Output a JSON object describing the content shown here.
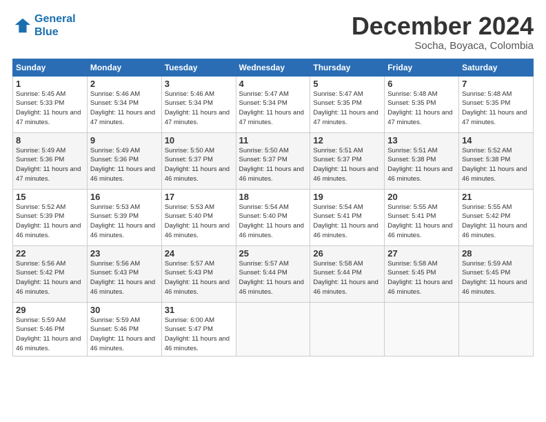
{
  "header": {
    "logo_line1": "General",
    "logo_line2": "Blue",
    "month": "December 2024",
    "location": "Socha, Boyaca, Colombia"
  },
  "weekdays": [
    "Sunday",
    "Monday",
    "Tuesday",
    "Wednesday",
    "Thursday",
    "Friday",
    "Saturday"
  ],
  "weeks": [
    [
      {
        "day": "1",
        "sunrise": "5:45 AM",
        "sunset": "5:33 PM",
        "daylight": "11 hours and 47 minutes."
      },
      {
        "day": "2",
        "sunrise": "5:46 AM",
        "sunset": "5:34 PM",
        "daylight": "11 hours and 47 minutes."
      },
      {
        "day": "3",
        "sunrise": "5:46 AM",
        "sunset": "5:34 PM",
        "daylight": "11 hours and 47 minutes."
      },
      {
        "day": "4",
        "sunrise": "5:47 AM",
        "sunset": "5:34 PM",
        "daylight": "11 hours and 47 minutes."
      },
      {
        "day": "5",
        "sunrise": "5:47 AM",
        "sunset": "5:35 PM",
        "daylight": "11 hours and 47 minutes."
      },
      {
        "day": "6",
        "sunrise": "5:48 AM",
        "sunset": "5:35 PM",
        "daylight": "11 hours and 47 minutes."
      },
      {
        "day": "7",
        "sunrise": "5:48 AM",
        "sunset": "5:35 PM",
        "daylight": "11 hours and 47 minutes."
      }
    ],
    [
      {
        "day": "8",
        "sunrise": "5:49 AM",
        "sunset": "5:36 PM",
        "daylight": "11 hours and 47 minutes."
      },
      {
        "day": "9",
        "sunrise": "5:49 AM",
        "sunset": "5:36 PM",
        "daylight": "11 hours and 46 minutes."
      },
      {
        "day": "10",
        "sunrise": "5:50 AM",
        "sunset": "5:37 PM",
        "daylight": "11 hours and 46 minutes."
      },
      {
        "day": "11",
        "sunrise": "5:50 AM",
        "sunset": "5:37 PM",
        "daylight": "11 hours and 46 minutes."
      },
      {
        "day": "12",
        "sunrise": "5:51 AM",
        "sunset": "5:37 PM",
        "daylight": "11 hours and 46 minutes."
      },
      {
        "day": "13",
        "sunrise": "5:51 AM",
        "sunset": "5:38 PM",
        "daylight": "11 hours and 46 minutes."
      },
      {
        "day": "14",
        "sunrise": "5:52 AM",
        "sunset": "5:38 PM",
        "daylight": "11 hours and 46 minutes."
      }
    ],
    [
      {
        "day": "15",
        "sunrise": "5:52 AM",
        "sunset": "5:39 PM",
        "daylight": "11 hours and 46 minutes."
      },
      {
        "day": "16",
        "sunrise": "5:53 AM",
        "sunset": "5:39 PM",
        "daylight": "11 hours and 46 minutes."
      },
      {
        "day": "17",
        "sunrise": "5:53 AM",
        "sunset": "5:40 PM",
        "daylight": "11 hours and 46 minutes."
      },
      {
        "day": "18",
        "sunrise": "5:54 AM",
        "sunset": "5:40 PM",
        "daylight": "11 hours and 46 minutes."
      },
      {
        "day": "19",
        "sunrise": "5:54 AM",
        "sunset": "5:41 PM",
        "daylight": "11 hours and 46 minutes."
      },
      {
        "day": "20",
        "sunrise": "5:55 AM",
        "sunset": "5:41 PM",
        "daylight": "11 hours and 46 minutes."
      },
      {
        "day": "21",
        "sunrise": "5:55 AM",
        "sunset": "5:42 PM",
        "daylight": "11 hours and 46 minutes."
      }
    ],
    [
      {
        "day": "22",
        "sunrise": "5:56 AM",
        "sunset": "5:42 PM",
        "daylight": "11 hours and 46 minutes."
      },
      {
        "day": "23",
        "sunrise": "5:56 AM",
        "sunset": "5:43 PM",
        "daylight": "11 hours and 46 minutes."
      },
      {
        "day": "24",
        "sunrise": "5:57 AM",
        "sunset": "5:43 PM",
        "daylight": "11 hours and 46 minutes."
      },
      {
        "day": "25",
        "sunrise": "5:57 AM",
        "sunset": "5:44 PM",
        "daylight": "11 hours and 46 minutes."
      },
      {
        "day": "26",
        "sunrise": "5:58 AM",
        "sunset": "5:44 PM",
        "daylight": "11 hours and 46 minutes."
      },
      {
        "day": "27",
        "sunrise": "5:58 AM",
        "sunset": "5:45 PM",
        "daylight": "11 hours and 46 minutes."
      },
      {
        "day": "28",
        "sunrise": "5:59 AM",
        "sunset": "5:45 PM",
        "daylight": "11 hours and 46 minutes."
      }
    ],
    [
      {
        "day": "29",
        "sunrise": "5:59 AM",
        "sunset": "5:46 PM",
        "daylight": "11 hours and 46 minutes."
      },
      {
        "day": "30",
        "sunrise": "5:59 AM",
        "sunset": "5:46 PM",
        "daylight": "11 hours and 46 minutes."
      },
      {
        "day": "31",
        "sunrise": "6:00 AM",
        "sunset": "5:47 PM",
        "daylight": "11 hours and 46 minutes."
      },
      null,
      null,
      null,
      null
    ]
  ]
}
